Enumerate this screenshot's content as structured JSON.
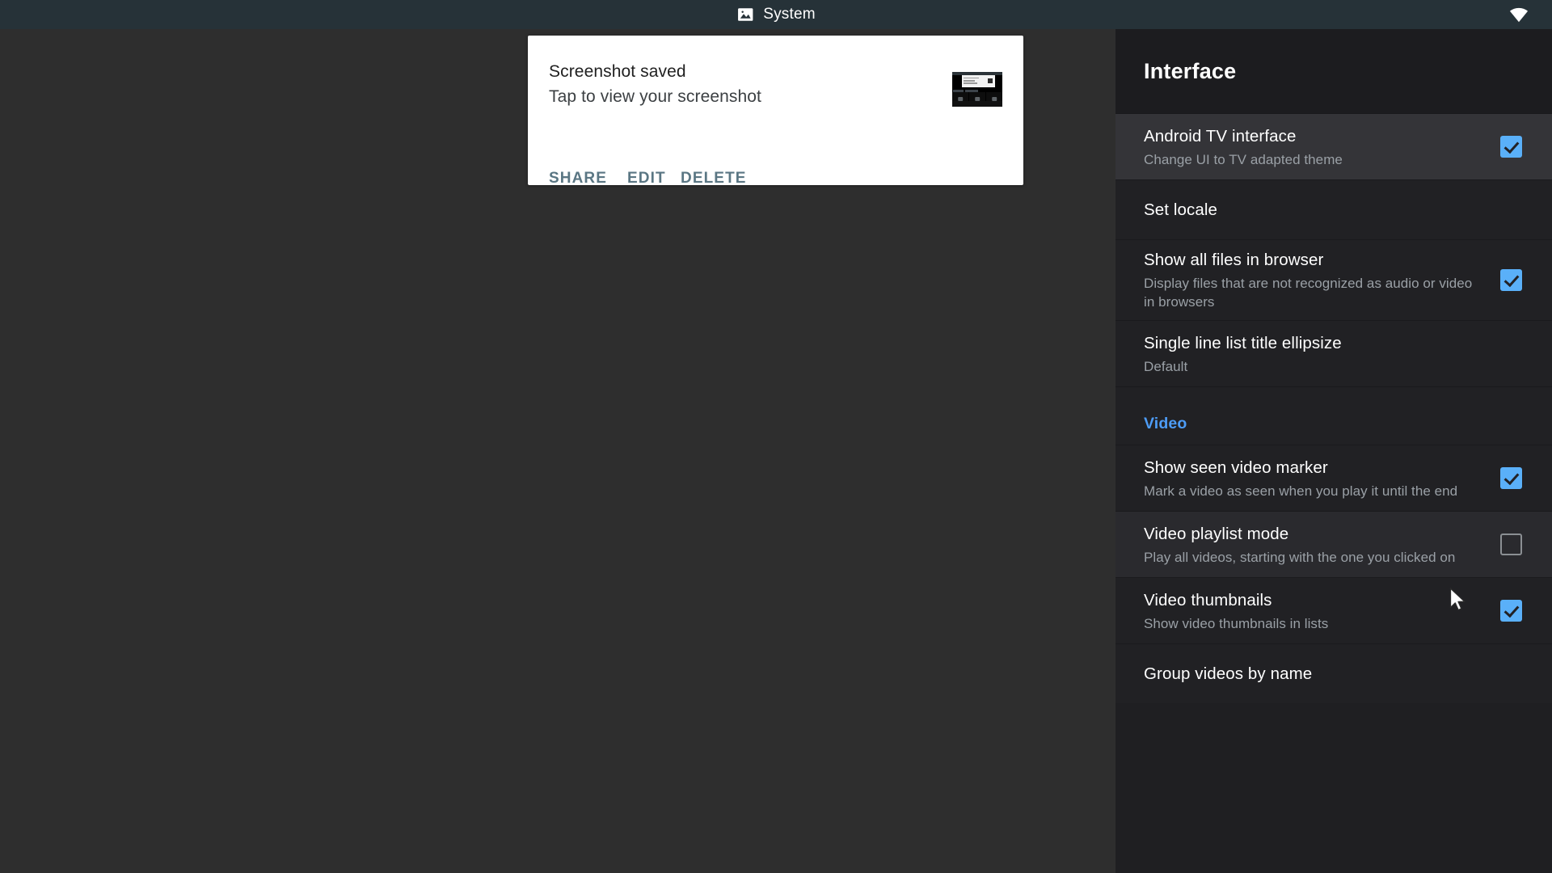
{
  "status_bar": {
    "app_icon": "photo-icon",
    "app_label": "System",
    "wifi_icon": "wifi-icon",
    "background_color": "#263238"
  },
  "notification": {
    "title": "Screenshot saved",
    "subtitle": "Tap to view your screenshot",
    "thumbnail_label": "screenshot-thumbnail",
    "actions": [
      {
        "label": "SHARE"
      },
      {
        "label": "EDIT"
      },
      {
        "label": "DELETE"
      }
    ],
    "action_color": "#5a7683",
    "background_color": "#ffffff"
  },
  "sidebar": {
    "header": {
      "title": "Interface"
    },
    "accent_color": "#4d9cf6",
    "checkbox_on_color": "#5ab0f9",
    "items": [
      {
        "title": "Android TV interface",
        "subtitle": "Change UI to TV adapted theme",
        "control": "checkbox",
        "checked": true,
        "state": "focused"
      },
      {
        "title": "Set locale",
        "subtitle": "",
        "control": "none",
        "checked": false,
        "state": "normal"
      },
      {
        "title": "Show all files in browser",
        "subtitle": "Display files that are not recognized as audio or video in browsers",
        "control": "checkbox",
        "checked": true,
        "state": "normal"
      },
      {
        "title": "Single line list title ellipsize",
        "subtitle": "Default",
        "control": "none",
        "checked": false,
        "state": "normal"
      },
      {
        "section": "Video"
      },
      {
        "title": "Show seen video marker",
        "subtitle": "Mark a video as seen when you play it until the end",
        "control": "checkbox",
        "checked": true,
        "state": "normal"
      },
      {
        "title": "Video playlist mode",
        "subtitle": "Play all videos, starting with the one you clicked on",
        "control": "checkbox",
        "checked": false,
        "state": "hovered"
      },
      {
        "title": "Video thumbnails",
        "subtitle": "Show video thumbnails in lists",
        "control": "checkbox",
        "checked": true,
        "state": "normal"
      },
      {
        "title": "Group videos by name",
        "subtitle": "",
        "control": "none",
        "checked": false,
        "state": "normal"
      }
    ]
  },
  "cursor": {
    "icon": "mouse-pointer-icon"
  }
}
